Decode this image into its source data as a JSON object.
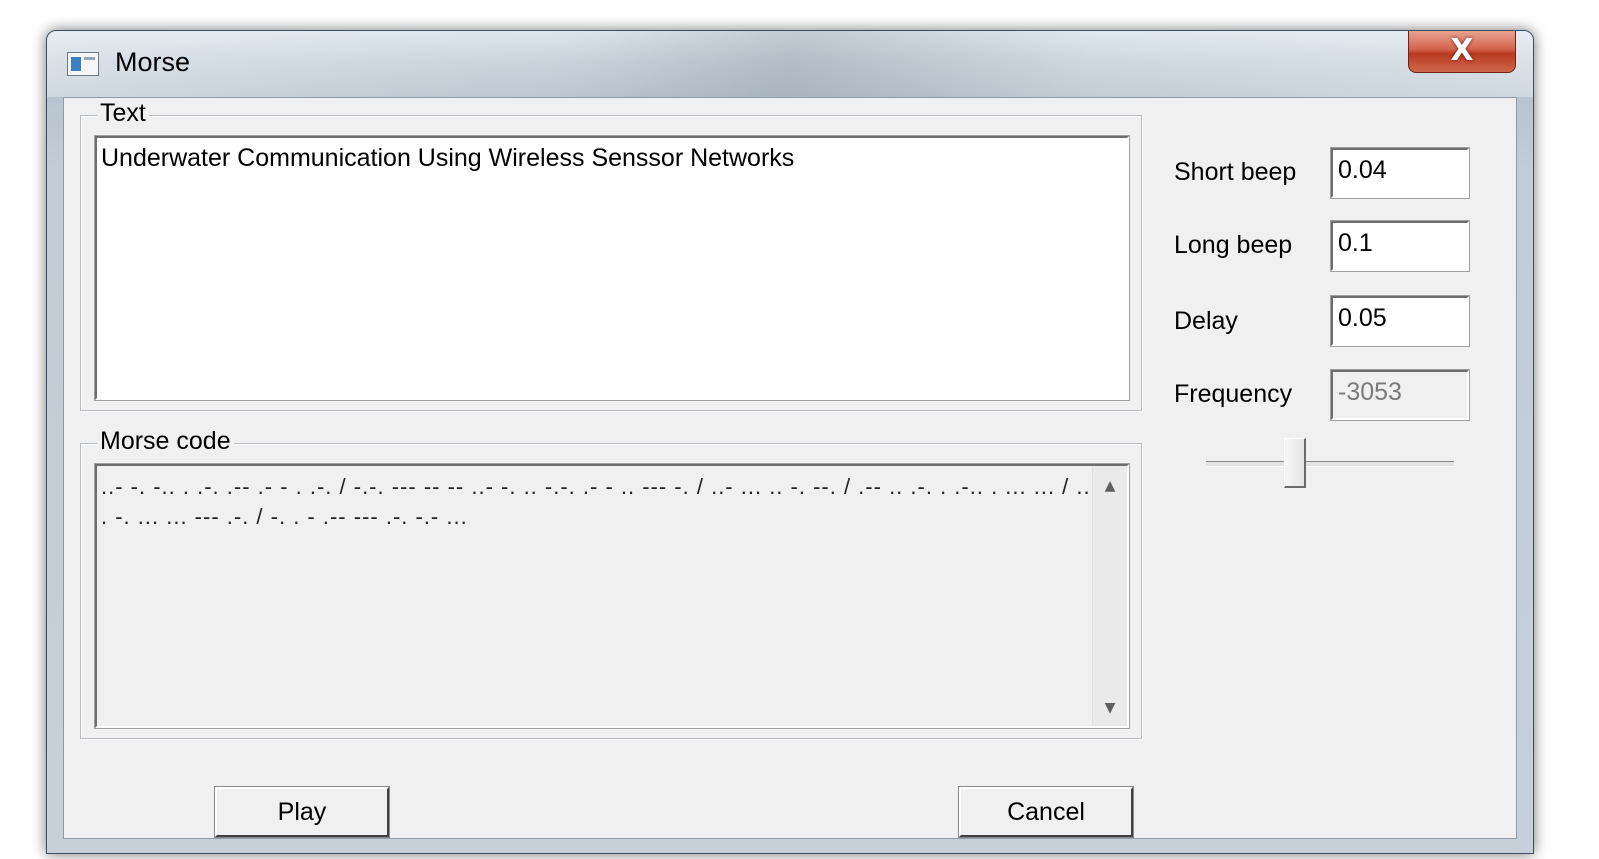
{
  "window": {
    "title": "Morse",
    "close_glyph": "X"
  },
  "text_group": {
    "label": "Text",
    "value": "Underwater Communication Using Wireless Senssor Networks"
  },
  "morse_group": {
    "label": "Morse code",
    "lines": [
      "..- -. -.. . .-. .-- .- - . .-. / -.-. --- -- -- ..- -. .. -.-. .- - .. --- -. / ..- ... .. -. --. / .-- .. .-. . .-.. . ... ... / ...",
      ". -. ... ... --- .-. / -. . - .-- --- .-. -.- ..."
    ],
    "scroll_up_glyph": "▲",
    "scroll_down_glyph": "▼"
  },
  "buttons": {
    "play_label": "Play",
    "cancel_label": "Cancel"
  },
  "settings": {
    "short_beep_label": "Short beep",
    "short_beep_value": "0.04",
    "long_beep_label": "Long beep",
    "long_beep_value": "0.1",
    "delay_label": "Delay",
    "delay_value": "0.05",
    "frequency_label": "Frequency",
    "frequency_value": "-3053",
    "frequency_slider_fraction": 0.36
  },
  "icons": {
    "app": "window-app-icon",
    "close": "close-icon",
    "scroll_up": "scroll-up-arrow-icon",
    "scroll_down": "scroll-down-arrow-icon"
  },
  "colors": {
    "close_button": "#c8462d",
    "client_background": "#f0f0f0",
    "titlebar": "#c6d1db"
  }
}
